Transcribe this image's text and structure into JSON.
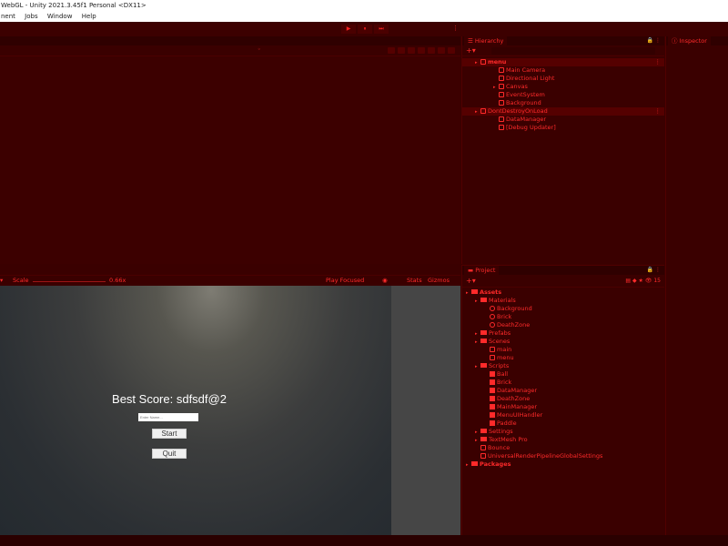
{
  "window": {
    "title": "WebGL - Unity 2021.3.45f1 Personal <DX11>"
  },
  "menu": {
    "items": [
      "nent",
      "Jobs",
      "Window",
      "Help"
    ]
  },
  "play": {
    "play": "▶",
    "pause": "⏸",
    "step": "⏭"
  },
  "game": {
    "scale_label": "Scale",
    "scale_value": "0.66x",
    "play_mode": "Play Focused",
    "stats": "Stats",
    "gizmos": "Gizmos",
    "best_score": "Best Score: sdfsdf@2",
    "name_placeholder": "Enter Name...",
    "start_label": "Start",
    "quit_label": "Quit"
  },
  "hierarchy": {
    "tab": "Hierarchy",
    "rows": [
      {
        "label": "menu",
        "indent": 1,
        "selected": true,
        "kebab": true,
        "bold": true
      },
      {
        "label": "Main Camera",
        "indent": 3
      },
      {
        "label": "Directional Light",
        "indent": 3
      },
      {
        "label": "Canvas",
        "indent": 3,
        "arrow": true
      },
      {
        "label": "EventSystem",
        "indent": 3
      },
      {
        "label": "Background",
        "indent": 3
      },
      {
        "label": "DontDestroyOnLoad",
        "indent": 1,
        "selected": true,
        "kebab": true,
        "arrow": true
      },
      {
        "label": "DataManager",
        "indent": 3
      },
      {
        "label": "[Debug Updater]",
        "indent": 3
      }
    ]
  },
  "inspector": {
    "tab": "Inspector"
  },
  "project": {
    "tab": "Project",
    "count": "15",
    "rows": [
      {
        "label": "Assets",
        "indent": 0,
        "type": "folder",
        "bold": true
      },
      {
        "label": "Materials",
        "indent": 1,
        "type": "folder"
      },
      {
        "label": "Background",
        "indent": 2,
        "type": "mat"
      },
      {
        "label": "Brick",
        "indent": 2,
        "type": "mat"
      },
      {
        "label": "DeathZone",
        "indent": 2,
        "type": "mat"
      },
      {
        "label": "Prefabs",
        "indent": 1,
        "type": "folder"
      },
      {
        "label": "Scenes",
        "indent": 1,
        "type": "folder"
      },
      {
        "label": "main",
        "indent": 2,
        "type": "scene"
      },
      {
        "label": "menu",
        "indent": 2,
        "type": "scene"
      },
      {
        "label": "Scripts",
        "indent": 1,
        "type": "folder"
      },
      {
        "label": "Ball",
        "indent": 2,
        "type": "script"
      },
      {
        "label": "Brick",
        "indent": 2,
        "type": "script"
      },
      {
        "label": "DataManager",
        "indent": 2,
        "type": "script"
      },
      {
        "label": "DeathZone",
        "indent": 2,
        "type": "script"
      },
      {
        "label": "MainManager",
        "indent": 2,
        "type": "script"
      },
      {
        "label": "MenuUIHandler",
        "indent": 2,
        "type": "script"
      },
      {
        "label": "Paddle",
        "indent": 2,
        "type": "script"
      },
      {
        "label": "Settings",
        "indent": 1,
        "type": "folder"
      },
      {
        "label": "TextMesh Pro",
        "indent": 1,
        "type": "folder"
      },
      {
        "label": "Bounce",
        "indent": 1,
        "type": "physmat"
      },
      {
        "label": "UniversalRenderPipelineGlobalSettings",
        "indent": 1,
        "type": "asset"
      },
      {
        "label": "Packages",
        "indent": 0,
        "type": "folder",
        "bold": true
      }
    ]
  },
  "colors": {
    "accent": "#ff2a2a",
    "panel": "#3a0000",
    "selected": "#550000"
  }
}
